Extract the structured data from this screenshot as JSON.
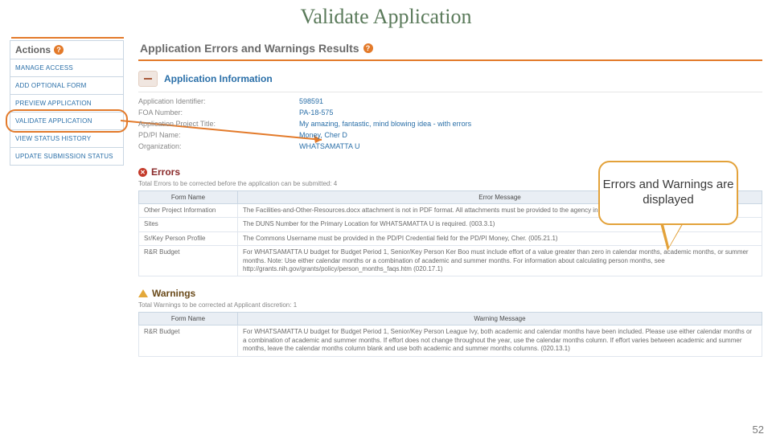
{
  "slide": {
    "title": "Validate Application",
    "page_number": "52"
  },
  "sidebar": {
    "header": "Actions",
    "items": [
      "MANAGE ACCESS",
      "ADD OPTIONAL FORM",
      "PREVIEW APPLICATION",
      "VALIDATE APPLICATION",
      "VIEW STATUS HISTORY",
      "UPDATE SUBMISSION STATUS"
    ]
  },
  "panel": {
    "title": "Application Errors and Warnings Results",
    "info_section": "Application Information",
    "info_rows": [
      {
        "label": "Application Identifier:",
        "value": "598591"
      },
      {
        "label": "FOA Number:",
        "value": "PA-18-575"
      },
      {
        "label": "Application Project Title:",
        "value": "My amazing, fantastic, mind blowing idea - with errors"
      },
      {
        "label": "PD/PI Name:",
        "value": "Money, Cher D"
      },
      {
        "label": "Organization:",
        "value": "WHATSAMATTA U"
      }
    ]
  },
  "callout": {
    "text": "Errors and Warnings are displayed"
  },
  "errors": {
    "heading": "Errors",
    "subnote": "Total Errors to be corrected before the application can be submitted: 4",
    "col1": "Form Name",
    "col2": "Error Message",
    "rows": [
      {
        "form": "Other Project Information",
        "msg": "The Facilities-and-Other-Resources.docx attachment is not in PDF format. All attachments must be provided to the agency in PDF format with a .pdf extension. (000.8)"
      },
      {
        "form": "Sites",
        "msg": "The DUNS Number for the Primary Location for WHATSAMATTA U is required. (003.3.1)"
      },
      {
        "form": "Sr/Key Person Profile",
        "msg": "The Commons Username must be provided in the PD/PI Credential field for the PD/PI Money, Cher. (005.21.1)"
      },
      {
        "form": "R&R Budget",
        "msg": "For WHATSAMATTA U budget for Budget Period 1, Senior/Key Person Ker Boo must include effort of a value greater than zero in calendar months, academic months, or summer months. Note: Use either calendar months or a combination of academic and summer months. For information about calculating person months, see http://grants.nih.gov/grants/policy/person_months_faqs.htm (020.17.1)"
      }
    ]
  },
  "warnings": {
    "heading": "Warnings",
    "subnote": "Total Warnings to be corrected at Applicant discretion: 1",
    "col1": "Form Name",
    "col2": "Warning Message",
    "rows": [
      {
        "form": "R&R Budget",
        "msg": "For WHATSAMATTA U budget for Budget Period 1, Senior/Key Person League Ivy, both academic and calendar months have been included. Please use either calendar months or a combination of academic and summer months. If effort does not change throughout the year, use the calendar months column. If effort varies between academic and summer months, leave the calendar months column blank and use both academic and summer months columns. (020.13.1)"
      }
    ]
  }
}
